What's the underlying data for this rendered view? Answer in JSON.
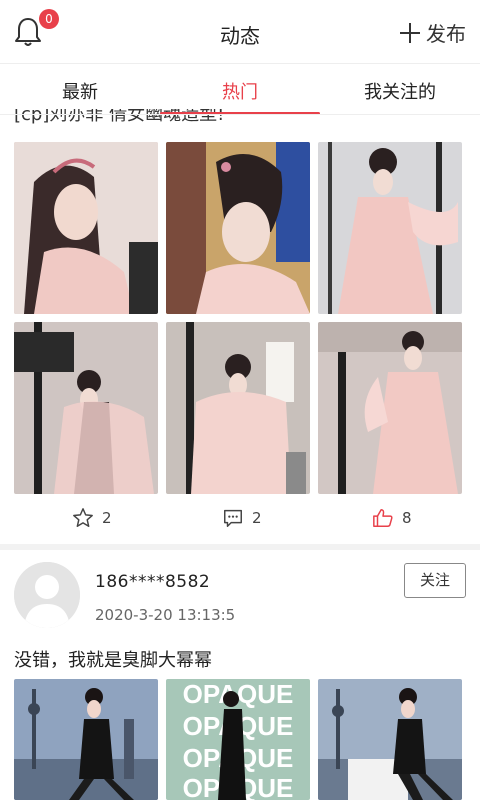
{
  "header": {
    "title": "动态",
    "publish_label": "发布",
    "notification_count": "0"
  },
  "tabs": [
    {
      "label": "最新",
      "active": false
    },
    {
      "label": "热门",
      "active": true
    },
    {
      "label": "我关注的",
      "active": false
    }
  ],
  "accent_color": "#e8404a",
  "post1": {
    "caption": "[cp]刘亦菲 倩女幽魂造型!",
    "image_count": 6,
    "favorites": "2",
    "comments": "2",
    "likes": "8"
  },
  "post2": {
    "username": "186****8582",
    "timestamp": "2020-3-20 13:13:5",
    "follow_label": "关注",
    "caption": "没错，我就是臭脚大幂幂",
    "opaque_text": "OPAQUE"
  }
}
